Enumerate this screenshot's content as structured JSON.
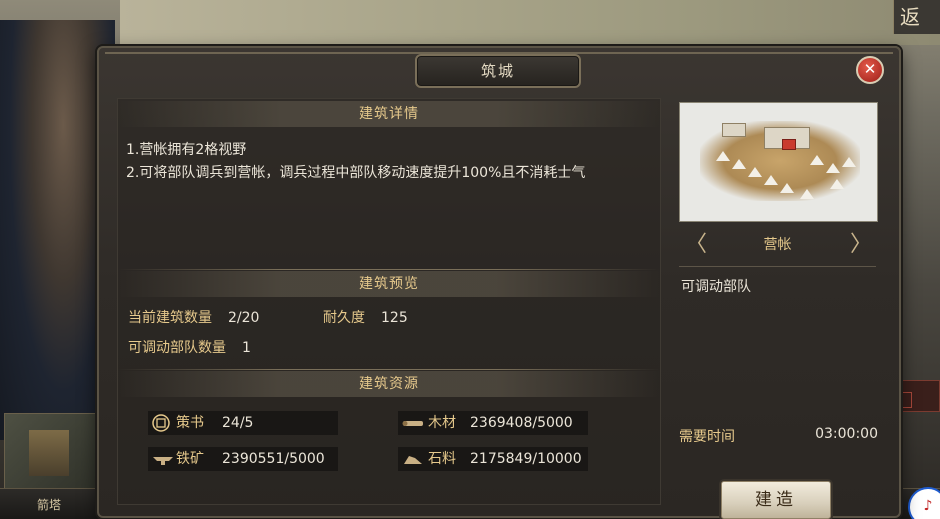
{
  "background": {
    "top_right_button": "返",
    "bottom_building_label": "箭塔",
    "corner_icon": "♪"
  },
  "dialog": {
    "title": "筑城",
    "close_icon": "✕",
    "details": {
      "heading": "建筑详情",
      "lines": [
        "1.营帐拥有2格视野",
        "2.可将部队调兵到营帐，调兵过程中部队移动速度提升100%且不消耗士气"
      ]
    },
    "preview": {
      "heading": "建筑预览",
      "current_count_label": "当前建筑数量",
      "current_count_value": "2/20",
      "durability_label": "耐久度",
      "durability_value": "125",
      "troops_label": "可调动部队数量",
      "troops_value": "1"
    },
    "resources": {
      "heading": "建筑资源",
      "items": [
        {
          "icon": "decree-icon",
          "label": "策书",
          "value": "24/5"
        },
        {
          "icon": "wood-icon",
          "label": "木材",
          "value": "2369408/5000"
        },
        {
          "icon": "iron-icon",
          "label": "铁矿",
          "value": "2390551/5000"
        },
        {
          "icon": "stone-icon",
          "label": "石料",
          "value": "2175849/10000"
        }
      ]
    },
    "building": {
      "name": "营帐",
      "prev_icon": "〈",
      "next_icon": "〉",
      "description": "可调动部队",
      "time_label": "需要时间",
      "time_value": "03:00:00",
      "build_button": "建造"
    }
  }
}
